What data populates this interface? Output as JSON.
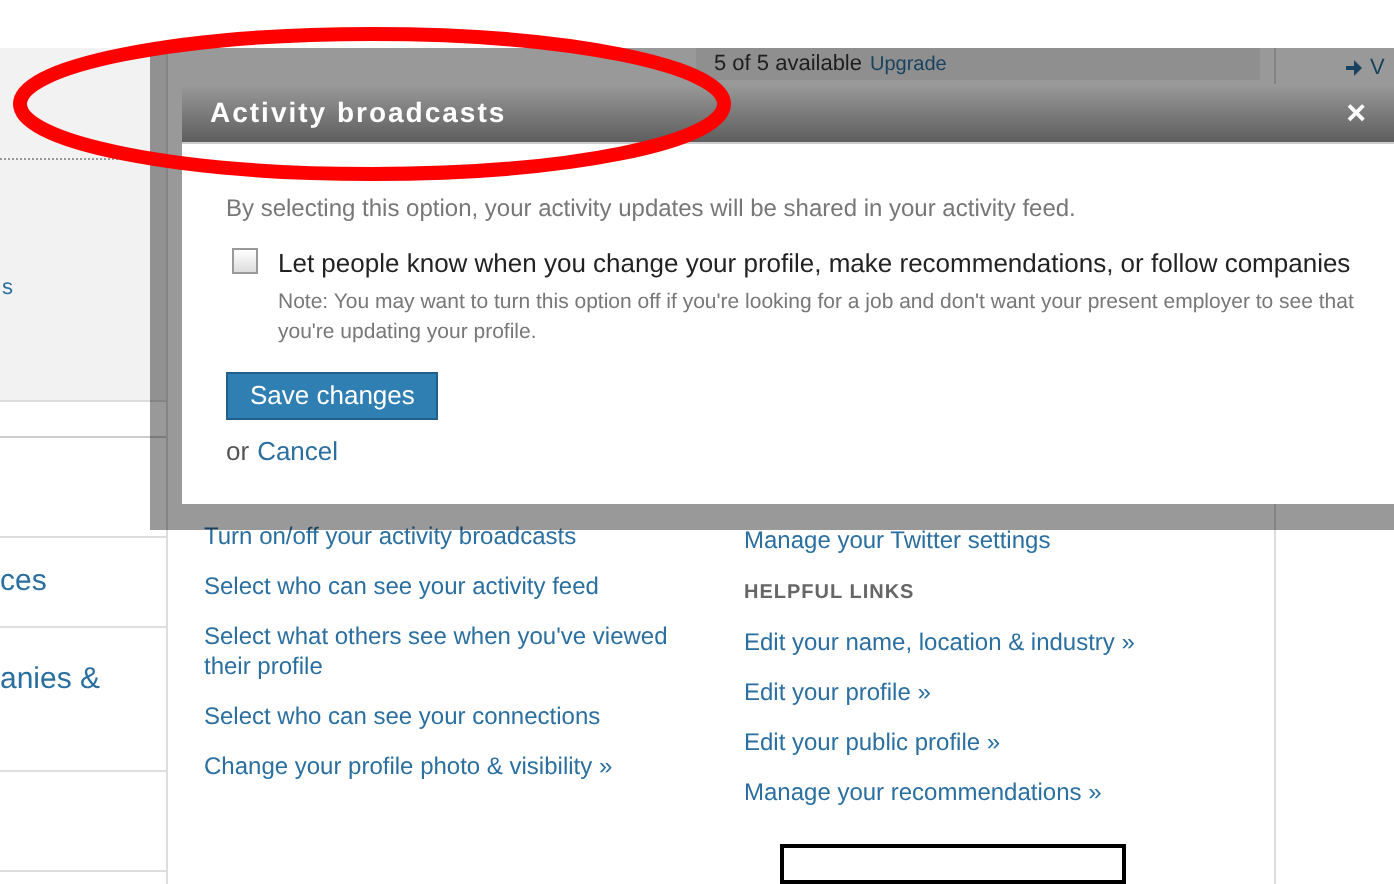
{
  "top_bar": {
    "availability": "5 of 5 available",
    "upgrade_link": "Upgrade",
    "side_link": "V"
  },
  "sidebar": {
    "items": [
      {
        "label": "s"
      },
      {
        "label": "ces"
      },
      {
        "label": "anies &"
      }
    ]
  },
  "dialog": {
    "title": "Activity broadcasts",
    "close": "×",
    "description": "By selecting this option, your activity updates will be shared in your activity feed.",
    "option": {
      "label": "Let people know when you change your profile, make recommendations, or follow companies",
      "checked": false,
      "note": "Note: You may want to turn this option off if you're looking for a job and don't want your present employer to see that you're updating your profile."
    },
    "save_button": "Save changes",
    "cancel_prefix": "or",
    "cancel_link": "Cancel"
  },
  "settings_links": [
    "Turn on/off your activity broadcasts",
    "Select who can see your activity feed",
    "Select what others see when you've viewed their profile",
    "Select who can see your connections",
    "Change your profile photo & visibility »"
  ],
  "right_column": {
    "first_link": "Manage your Twitter settings",
    "heading": "HELPFUL LINKS",
    "links": [
      "Edit your name, location & industry »",
      "Edit your profile »",
      "Edit your public profile »",
      "Manage your recommendations »"
    ]
  }
}
